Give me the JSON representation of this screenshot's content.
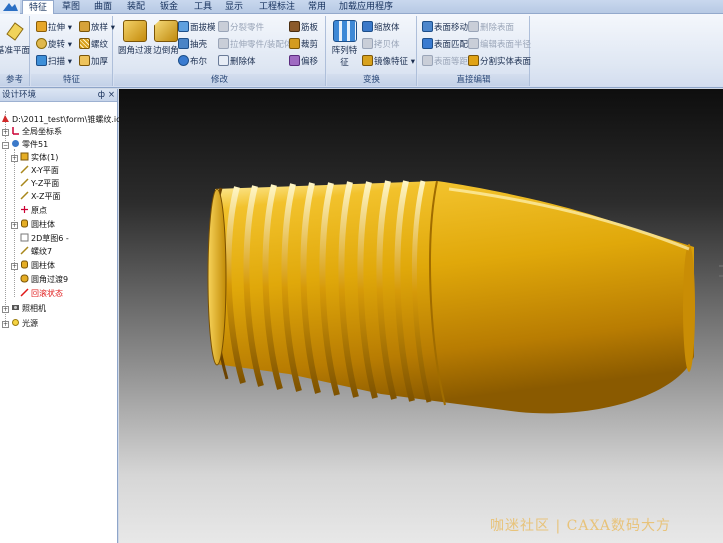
{
  "tabs": [
    "特征",
    "草图",
    "曲面",
    "装配",
    "钣金",
    "工具",
    "显示",
    "工程标注",
    "常用",
    "加载应用程序"
  ],
  "ribbon": {
    "groups": {
      "reference": "参考",
      "feature": "特征",
      "modify": "修改",
      "transform": "变换",
      "direct_edit": "直接编辑"
    },
    "base_plane": "基准平面",
    "feature_items": [
      "拉伸",
      "旋转",
      "扫描",
      "放样",
      "螺纹",
      "加厚"
    ],
    "fillet": "圆角过渡",
    "chamfer": "边倒角",
    "modify_items": [
      "面拔模",
      "抽壳",
      "布尔",
      "分裂零件",
      "拉伸零件/装配体",
      "删除体",
      "筋板",
      "裁剪",
      "偏移"
    ],
    "pattern": "阵列特征",
    "transform_items": [
      "缩放体",
      "拷贝体",
      "镜像特征"
    ],
    "direct_items": [
      "表面移动",
      "表面匹配",
      "表面等距",
      "删除表面",
      "编辑表面半径",
      "分割实体表面"
    ]
  },
  "panel": {
    "title": "设计环境",
    "pin": "ф",
    "close": "×",
    "tree": [
      {
        "label": "D:\\2011_test\\form\\锥螺纹.ics",
        "level": 0
      },
      {
        "label": "全局坐标系",
        "level": 1
      },
      {
        "label": "零件51",
        "level": 1
      },
      {
        "label": "实体(1)",
        "level": 2
      },
      {
        "label": "X-Y平面",
        "level": 2
      },
      {
        "label": "Y-Z平面",
        "level": 2
      },
      {
        "label": "X-Z平面",
        "level": 2
      },
      {
        "label": "原点",
        "level": 2
      },
      {
        "label": "圆柱体",
        "level": 2
      },
      {
        "label": "2D草图6",
        "level": 2
      },
      {
        "label": "螺纹7",
        "level": 2
      },
      {
        "label": "圆柱体",
        "level": 2
      },
      {
        "label": "圆角过渡9",
        "level": 2
      },
      {
        "label": "回滚状态",
        "level": 2
      },
      {
        "label": "照相机",
        "level": 1
      },
      {
        "label": "光源",
        "level": 1
      }
    ]
  },
  "watermark": "咖迷社区 | CAXA数码大方",
  "colors": {
    "model_gold": "#e0a80a",
    "ribbon_bg": "#dfe7f3",
    "rollback_red": "#e01818"
  }
}
